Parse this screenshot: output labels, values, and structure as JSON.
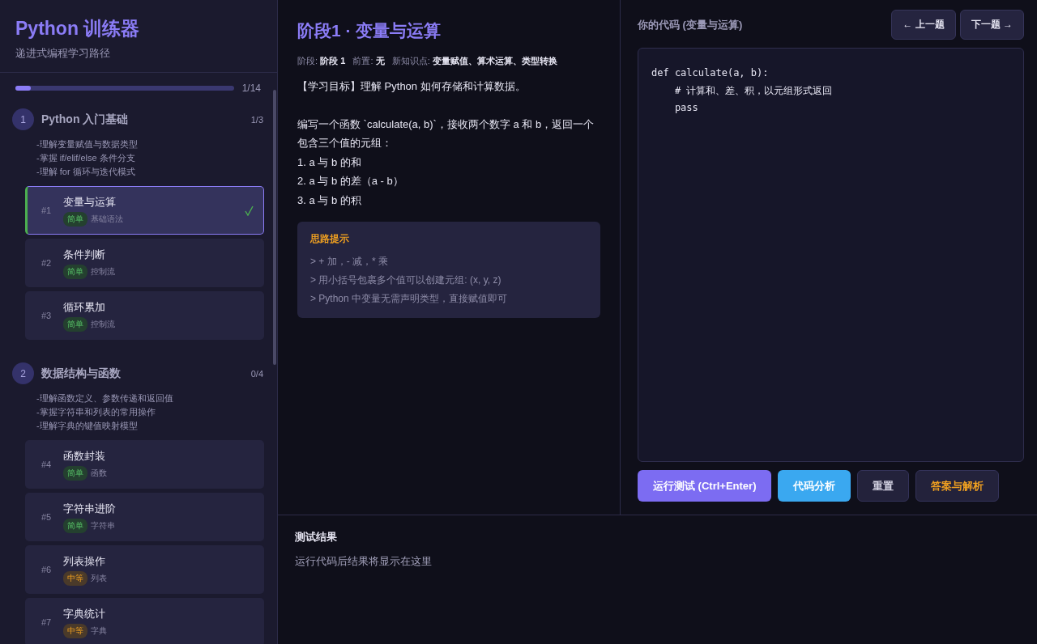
{
  "sidebar": {
    "title": "Python 训练器",
    "subtitle": "递进式编程学习路径",
    "progress": {
      "level": 0.07,
      "reading": "1/14"
    },
    "groups": [
      {
        "number": "1",
        "title": "Python 入门基础",
        "count": "1/3",
        "goals": [
          "-理解变量赋值与数据类型",
          "-掌握 if/elif/else 条件分支",
          "-理解 for 循环与迭代模式"
        ],
        "items": [
          {
            "number": "#1",
            "title": "变量与运算",
            "tag": {
              "label": "简单",
              "kind": "easy"
            },
            "topic": "基础语法",
            "selected": true,
            "done": true
          },
          {
            "number": "#2",
            "title": "条件判断",
            "tag": {
              "label": "简单",
              "kind": "easy"
            },
            "topic": "控制流",
            "selected": false,
            "done": false
          },
          {
            "number": "#3",
            "title": "循环累加",
            "tag": {
              "label": "简单",
              "kind": "easy"
            },
            "topic": "控制流",
            "selected": false,
            "done": false
          }
        ]
      },
      {
        "number": "2",
        "title": "数据结构与函数",
        "count": "0/4",
        "goals": [
          "-理解函数定义、参数传递和返回值",
          "-掌握字符串和列表的常用操作",
          "-理解字典的键值映射模型"
        ],
        "items": [
          {
            "number": "#4",
            "title": "函数封装",
            "tag": {
              "label": "简单",
              "kind": "easy"
            },
            "topic": "函数",
            "selected": false,
            "done": false
          },
          {
            "number": "#5",
            "title": "字符串进阶",
            "tag": {
              "label": "简单",
              "kind": "easy"
            },
            "topic": "字符串",
            "selected": false,
            "done": false
          },
          {
            "number": "#6",
            "title": "列表操作",
            "tag": {
              "label": "中等",
              "kind": "medium"
            },
            "topic": "列表",
            "selected": false,
            "done": false
          },
          {
            "number": "#7",
            "title": "字典统计",
            "tag": {
              "label": "中等",
              "kind": "medium"
            },
            "topic": "字典",
            "selected": false,
            "done": false
          }
        ]
      }
    ]
  },
  "problem": {
    "title": "阶段1 · 变量与运算",
    "meta": "阶段: **阶段 1**   前置: **无**   新知识点: **变量赋值、算术运算、类型转换**",
    "goal": "【学习目标】理解 Python 如何存储和计算数据。",
    "description": [
      "编写一个函数 `calculate(a, b)`，接收两个数字 a 和 b，返回一个包含三个值的元组：",
      "1. a 与 b 的和",
      "2. a 与 b 的差（a - b）",
      "3. a 与 b 的积"
    ],
    "hints": {
      "title": "思路提示",
      "lines": [
        "> + 加，- 减，* 乘",
        "> 用小括号包裹多个值可以创建元组: (x, y, z)",
        "> Python 中变量无需声明类型，直接赋值即可"
      ]
    }
  },
  "editor": {
    "title": "你的代码 (变量与运算)",
    "prev": "← 上一题",
    "next": "下一题 →",
    "code": "def calculate(a, b):\n    # 计算和、差、积，以元组形式返回\n    pass",
    "buttons": [
      {
        "label": "运行测试 (Ctrl+Enter)",
        "kind": "primary"
      },
      {
        "label": "代码分析",
        "kind": "info"
      },
      {
        "label": "重置",
        "kind": "plain"
      },
      {
        "label": "答案与解析",
        "kind": "warning"
      }
    ]
  },
  "results": {
    "title": "测试结果",
    "message": "运行代码后结果将显示在这里"
  }
}
